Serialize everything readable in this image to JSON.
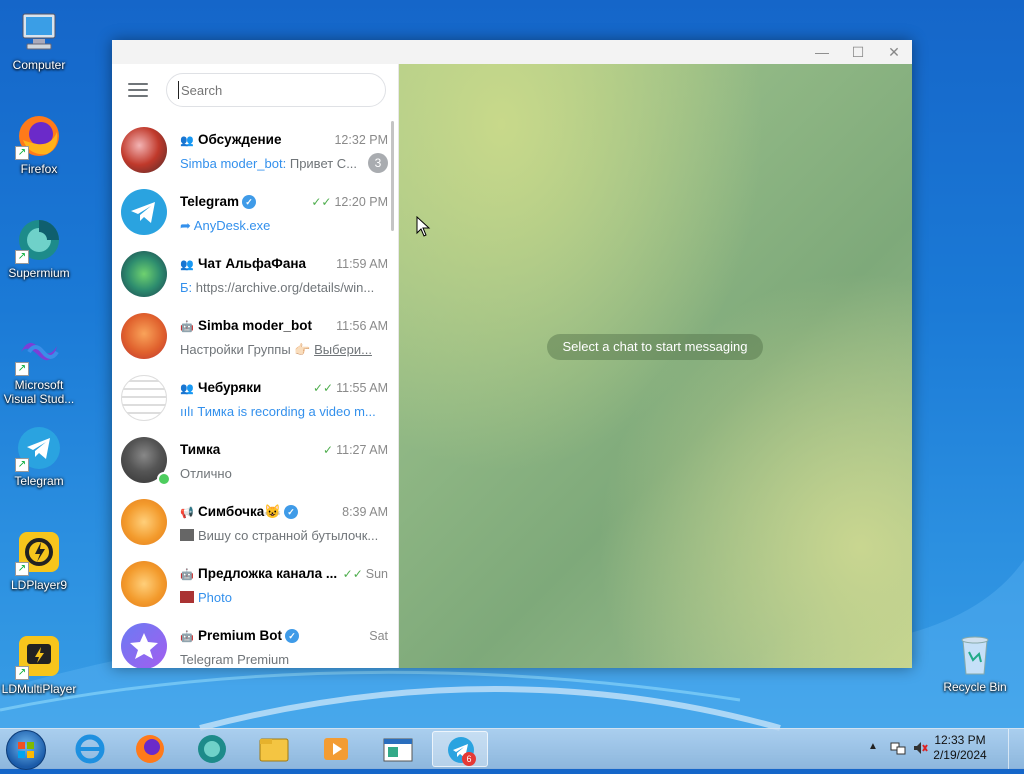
{
  "desktop": {
    "icons": [
      {
        "label": "Computer",
        "icon": "computer-icon"
      },
      {
        "label": "Firefox",
        "icon": "firefox-icon"
      },
      {
        "label": "Supermium",
        "icon": "supermium-icon"
      },
      {
        "label": "Microsoft Visual Stud...",
        "icon": "visual-studio-icon"
      },
      {
        "label": "Telegram",
        "icon": "telegram-icon"
      },
      {
        "label": "LDPlayer9",
        "icon": "ldplayer-icon"
      },
      {
        "label": "LDMultiPlayer",
        "icon": "ldmultiplayer-icon"
      },
      {
        "label": "Recycle Bin",
        "icon": "recycle-bin-icon"
      }
    ]
  },
  "window": {
    "controls": {
      "minimize": "—",
      "maximize": "☐",
      "close": "✕"
    }
  },
  "sidebar": {
    "search_placeholder": "Search",
    "chats": [
      {
        "name": "Обсуждение",
        "time": "12:32 PM",
        "sender": "Simba moder_bot:",
        "message": " Привет С...",
        "unread": "3",
        "type": "group"
      },
      {
        "name": "Telegram",
        "time": "12:20 PM",
        "message": "AnyDesk.exe",
        "type": "verified"
      },
      {
        "name": "Чат АльфаФана",
        "time": "11:59 AM",
        "message": "https://archive.org/details/win...",
        "type": "group"
      },
      {
        "name": "Simba moder_bot",
        "time": "11:56 AM",
        "message": "Настройки Группы 👉🏻 ",
        "link": "Выбери...",
        "type": "bot"
      },
      {
        "name": "Чебуряки",
        "time": "11:55 AM",
        "message": "Тимка is recording a video m...",
        "type": "group"
      },
      {
        "name": "Тимка",
        "time": "11:27 AM",
        "message": "Отлично",
        "type": "user"
      },
      {
        "name": "Симбочка😺",
        "time": "8:39 AM",
        "message": "Вишу со странной бутылочк...",
        "type": "channel"
      },
      {
        "name": "Предложка канала ...",
        "time": "Sun",
        "message": "Photo",
        "type": "bot"
      },
      {
        "name": "Premium Bot",
        "time": "Sat",
        "message": "Telegram Premium",
        "type": "bot"
      }
    ]
  },
  "chat_area": {
    "placeholder": "Select a chat to start messaging"
  },
  "taskbar": {
    "telegram_badge": "6",
    "clock_time": "12:33 PM",
    "clock_date": "2/19/2024"
  }
}
